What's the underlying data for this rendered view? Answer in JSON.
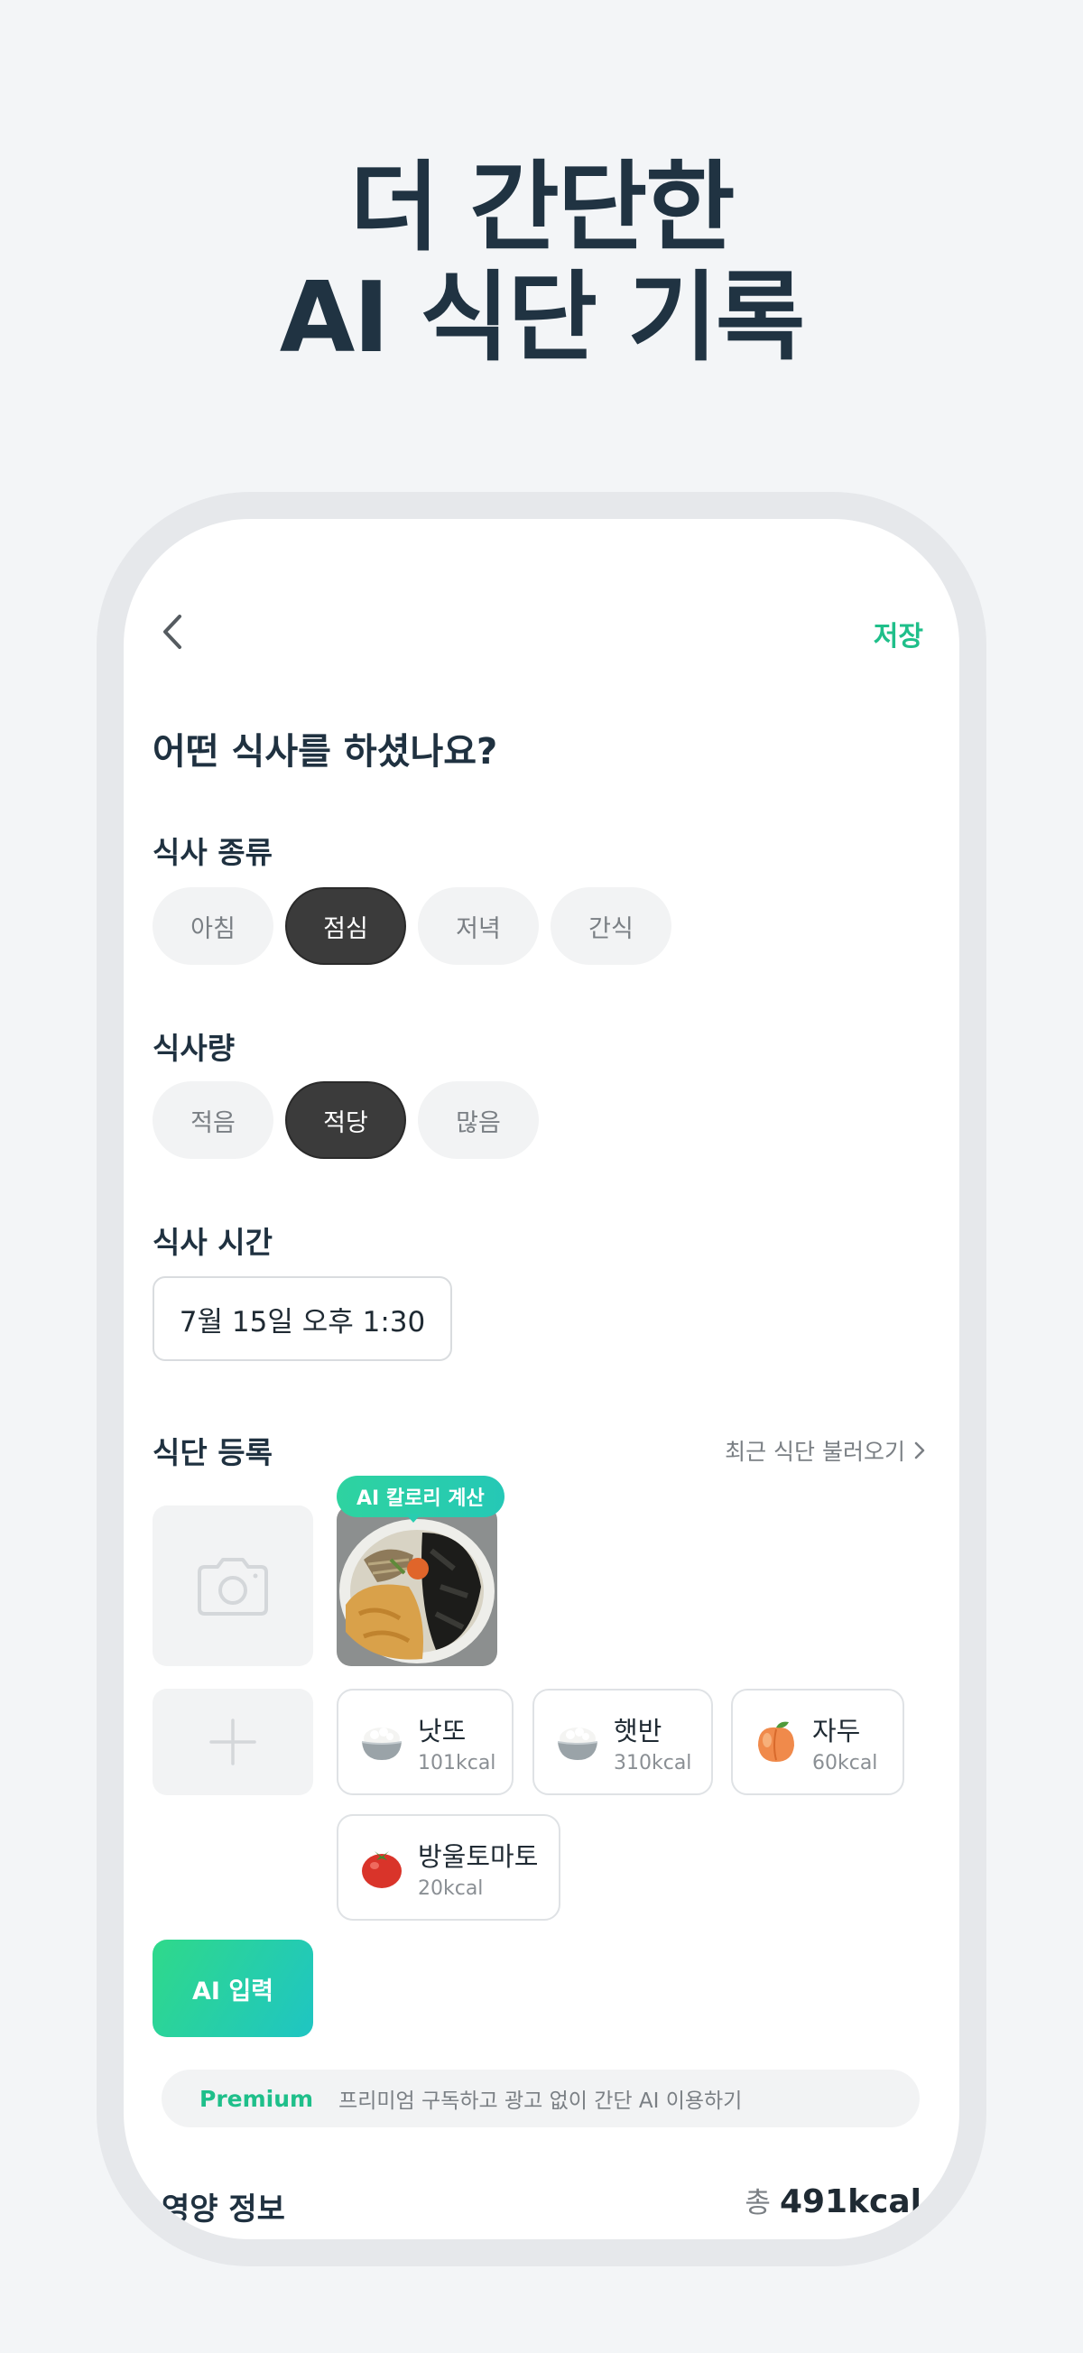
{
  "headline": {
    "line1": "더 간단한",
    "line2": "AI 식단 기록"
  },
  "header": {
    "save_label": "저장"
  },
  "question": "어떤 식사를 하셨나요?",
  "meal_type": {
    "label": "식사 종류",
    "options": [
      "아침",
      "점심",
      "저녁",
      "간식"
    ],
    "selected": "점심"
  },
  "meal_amount": {
    "label": "식사량",
    "options": [
      "적음",
      "적당",
      "많음"
    ],
    "selected": "적당"
  },
  "meal_time": {
    "label": "식사 시간",
    "value": "7월 15일 오후 1:30"
  },
  "meal_register": {
    "label": "식단 등록",
    "recent_link": "최근 식단 불러오기",
    "ai_badge": "AI 칼로리 계산"
  },
  "foods": [
    {
      "name": "낫또",
      "kcal": "101kcal",
      "icon": "rice-bowl-icon"
    },
    {
      "name": "햇반",
      "kcal": "310kcal",
      "icon": "rice-bowl-icon"
    },
    {
      "name": "자두",
      "kcal": "60kcal",
      "icon": "peach-icon"
    },
    {
      "name": "방울토마토",
      "kcal": "20kcal",
      "icon": "tomato-icon"
    }
  ],
  "ai_input_label": "AI 입력",
  "premium": {
    "tag": "Premium",
    "text": "프리미엄 구독하고 광고 없이 간단 AI 이용하기"
  },
  "nutrition": {
    "title": "영양 정보",
    "total_prefix": "총",
    "total_value": "491kcal"
  },
  "colors": {
    "accent": "#1fbf8a",
    "chip_active": "#3b3b3b",
    "background": "#f3f5f7"
  }
}
